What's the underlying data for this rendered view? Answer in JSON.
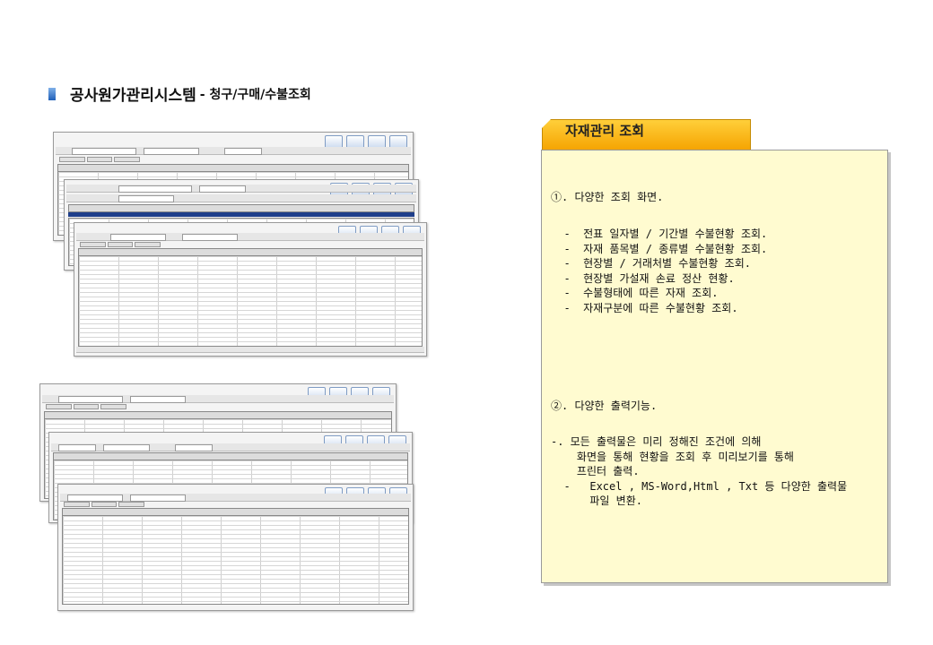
{
  "title": {
    "main": "공사원가관리시스템",
    "sub": "- 청구/구매/수불조회"
  },
  "panel": {
    "tab_title": "자재관리 조회",
    "section1": {
      "heading": "①. 다양한 조회 화면.",
      "items": [
        "  -  전표 일자별 / 기간별 수불현황 조회.",
        "  -  자재 품목별 / 종류별 수불현황 조회.",
        "  -  현장별 / 거래처별 수불현황 조회.",
        "  -  현장별 가설재 손료 정산 현황.",
        "  -  수불형태에 따른 자재 조회.",
        "  -  자재구분에 따른 수불현황 조회."
      ]
    },
    "section2": {
      "heading": "②. 다양한 출력기능.",
      "items": [
        "-. 모든 출력물은 미리 정해진 조건에 의해",
        "    화면을 통해 현황을 조회 후 미리보기를 통해",
        "    프린터 출력.",
        "  -   Excel , MS-Word,Html , Txt 등 다양한 출력물",
        "      파일 변환."
      ]
    }
  }
}
